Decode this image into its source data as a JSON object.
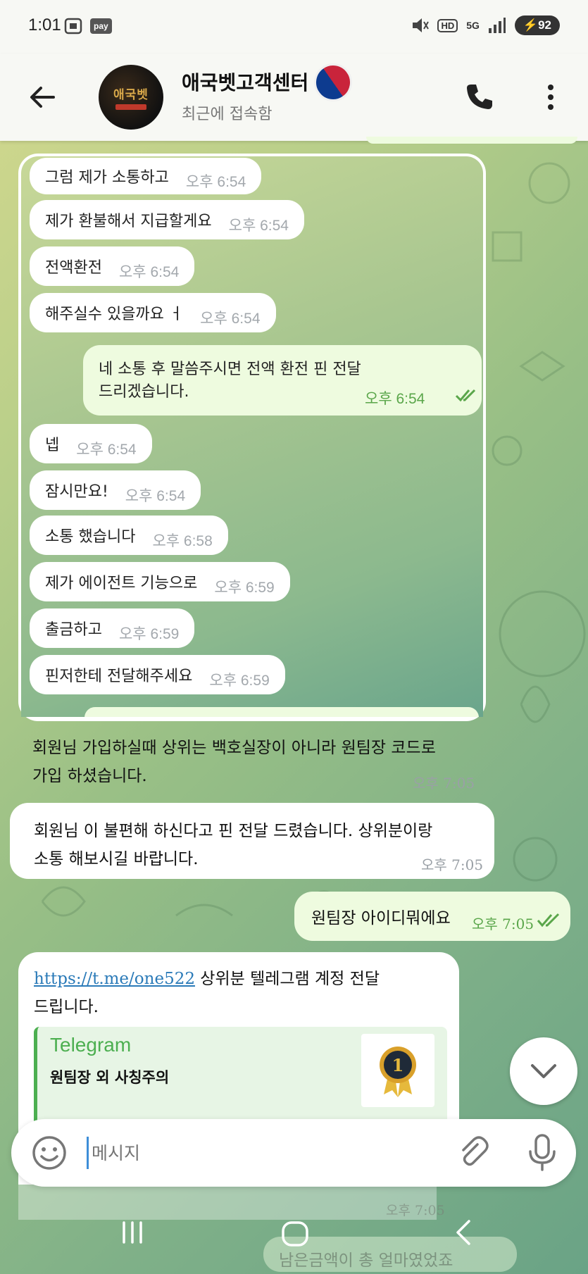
{
  "status_bar": {
    "time": "1:01",
    "pay_label": "pay",
    "hd_label": "HD",
    "net_label": "5G",
    "battery": "92"
  },
  "header": {
    "title": "애국벳고객센터",
    "status": "최근에 접속함",
    "avatar_text": "애국벳"
  },
  "screenshot_messages": [
    {
      "text": "그럼 제가 소통하고",
      "time": "오후 6:54"
    },
    {
      "text": "제가 환불해서 지급할게요",
      "time": "오후 6:54"
    },
    {
      "text": "전액환전",
      "time": "오후 6:54"
    },
    {
      "text": "해주실수 있을까요 ㅓ",
      "time": "오후 6:54"
    },
    {
      "text_line1": "네 소통 후 말씀주시면 전액 환전 핀 전달",
      "text_line2": "드리겠습니다.",
      "time": "오후 6:54"
    },
    {
      "text": "넵",
      "time": "오후 6:54"
    },
    {
      "text": "잠시만요!",
      "time": "오후 6:54"
    },
    {
      "text": "소통 했습니다",
      "time": "오후 6:58"
    },
    {
      "text": "제가 에이전트 기능으로",
      "time": "오후 6:59"
    },
    {
      "text": "출금하고",
      "time": "오후 6:59"
    },
    {
      "text": "핀저한테 전달해주세요",
      "time": "오후 6:59"
    }
  ],
  "messages": [
    {
      "line1": "회원님 가입하실때 상위는 백호실장이 아니라 원팀장 코드로",
      "line2": "가입 하셨습니다.",
      "time": "오후 7:05"
    },
    {
      "line1": "회원님 이 불편해 하신다고 핀 전달 드렸습니다. 상위분이랑",
      "line2": "소통 해보시길 바랍니다.",
      "time": "오후 7:05"
    },
    {
      "text": "원팀장 아이디뭐에요",
      "time": "오후 7:05"
    },
    {
      "link": "https://t.me/one522",
      "line1_rest": " 상위분 텔레그램 계정 전달",
      "line2": "드립니다.",
      "time": "오후 7:05"
    }
  ],
  "link_preview": {
    "site": "Telegram",
    "title": "원팀장 외 사칭주의"
  },
  "bottom_partial": "남은금액이 총 얼마였었죠",
  "input": {
    "placeholder": "메시지"
  },
  "colors": {
    "accent": "#3e8ed8",
    "outgoing_bubble": "#eefbdf",
    "read_check": "#5aa64a",
    "telegram_green": "#4caf50"
  }
}
